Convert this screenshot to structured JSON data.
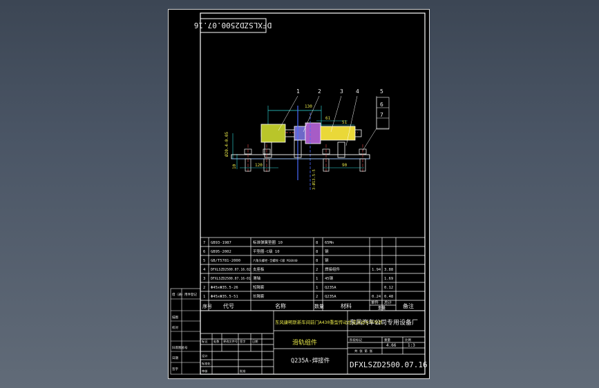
{
  "drawing": {
    "rotated_number": "DFXLSZD2500.07.16",
    "drawing_number": "DFXLSZD2500.07.16",
    "material": "Q235A-焊接件",
    "product_title": "东风康明斯新车间前门A430重型传动总成自动水平导轨",
    "company": "东风汽车公司专用设备厂",
    "part_name": "滑轨组件",
    "scale": "1:3",
    "weight": "4.66"
  },
  "callouts": [
    "1",
    "2",
    "3",
    "4",
    "5",
    "6",
    "7"
  ],
  "dimensions": {
    "top_length": "130",
    "right_span": "61",
    "right_span2": "51",
    "left_base": "120",
    "right_base": "90",
    "height": "Ø20.4-0.05",
    "base_thk": "10",
    "vertical": "3-Ø13.5-5"
  },
  "parts_table": {
    "headers": {
      "seq": "序号",
      "code": "代号",
      "name": "名称",
      "qty": "数量",
      "material": "材料",
      "unit_weight": "单件",
      "total_weight": "总计",
      "remark": "备注",
      "weight_group": "重量"
    },
    "rows": [
      {
        "seq": "7",
        "code": "GB93-1987",
        "name": "标准弹簧垫圈 10",
        "qty": "8",
        "material": "65Mn",
        "unit_weight": "",
        "total_weight": ""
      },
      {
        "seq": "6",
        "code": "GB95-2002",
        "name": "平垫圈-C级 10",
        "qty": "8",
        "material": "钢",
        "unit_weight": "",
        "total_weight": ""
      },
      {
        "seq": "5",
        "code": "GB/T5781-2000",
        "name": "六角头螺栓-全螺纹-C级 M10X40",
        "qty": "8",
        "material": "钢",
        "unit_weight": "",
        "total_weight": ""
      },
      {
        "seq": "4",
        "code": "DFXLSZD2500.07.16.02",
        "name": "支座板",
        "qty": "2",
        "material": "焊接组件",
        "unit_weight": "1.94",
        "total_weight": "3.88"
      },
      {
        "seq": "3",
        "code": "DFXLSZD2500.07.16-01",
        "name": "滑轴",
        "qty": "1",
        "material": "45钢",
        "unit_weight": "",
        "total_weight": "1.69"
      },
      {
        "seq": "2",
        "code": "Φ45xΦ35.5-26",
        "name": "短隔套",
        "qty": "1",
        "material": "Q235A",
        "unit_weight": "",
        "total_weight": "0.12"
      },
      {
        "seq": "1",
        "code": "Φ45xΦ35.5-51",
        "name": "长隔套",
        "qty": "2",
        "material": "Q235A",
        "unit_weight": "0.24",
        "total_weight": "0.48"
      }
    ]
  },
  "side_labels": {
    "used_on": "借（通）用件登记",
    "trace": "描图",
    "check": "校对",
    "archive": "旧底图总号",
    "date": "日期",
    "sign": "签字"
  },
  "revision_labels": {
    "mark": "标记",
    "count": "处数",
    "change_no": "更改文件号",
    "signature": "签字",
    "date": "日期",
    "design": "设计",
    "std": "标准化",
    "review": "审核",
    "approve": "批准"
  },
  "block_labels": {
    "stage": "阶段标记",
    "weight": "重量",
    "scale": "比例",
    "sheet": "共 张 第 张"
  }
}
